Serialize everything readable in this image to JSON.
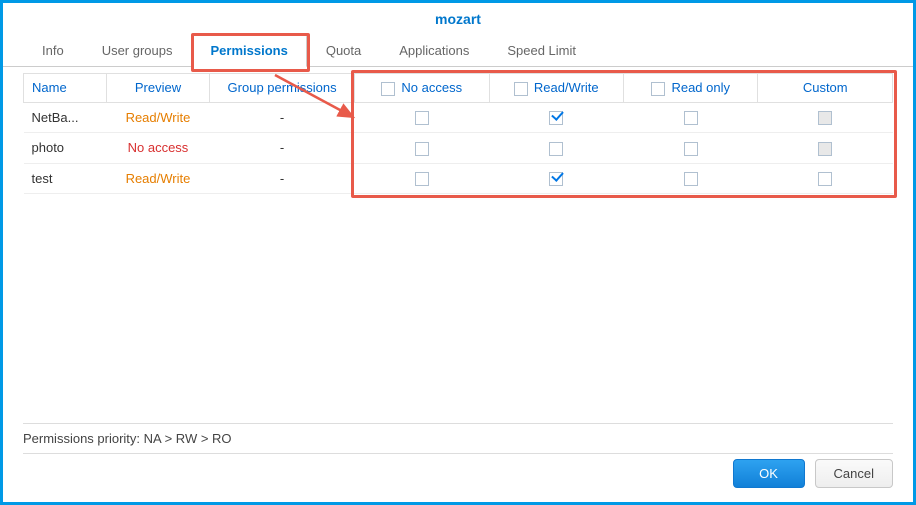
{
  "title": "mozart",
  "tabs": [
    "Info",
    "User groups",
    "Permissions",
    "Quota",
    "Applications",
    "Speed Limit"
  ],
  "active_tab": 2,
  "columns": {
    "name": "Name",
    "preview": "Preview",
    "group": "Group permissions",
    "perms": [
      "No access",
      "Read/Write",
      "Read only",
      "Custom"
    ]
  },
  "rows": [
    {
      "name": "NetBa...",
      "preview": "Read/Write",
      "preview_style": "orange",
      "group": "-",
      "no_access": false,
      "read_write": true,
      "read_only": false,
      "custom": false,
      "custom_disabled": true
    },
    {
      "name": "photo",
      "preview": "No access",
      "preview_style": "red",
      "group": "-",
      "no_access": false,
      "read_write": false,
      "read_only": false,
      "custom": false,
      "custom_disabled": true
    },
    {
      "name": "test",
      "preview": "Read/Write",
      "preview_style": "orange",
      "group": "-",
      "no_access": false,
      "read_write": true,
      "read_only": false,
      "custom": false,
      "custom_disabled": false
    }
  ],
  "priority_text": "Permissions priority: NA > RW > RO",
  "buttons": {
    "ok": "OK",
    "cancel": "Cancel"
  }
}
